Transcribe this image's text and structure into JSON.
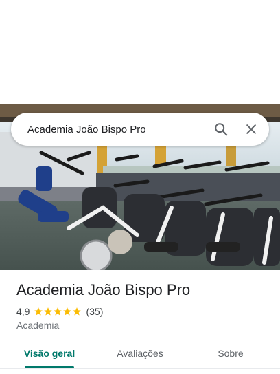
{
  "search": {
    "query": "Academia João Bispo Pro",
    "search_icon": "search-icon",
    "close_icon": "close-icon"
  },
  "hero": {
    "icon": "gym-photo"
  },
  "place": {
    "name": "Academia João Bispo Pro",
    "rating": "4,9",
    "stars": 5,
    "reviews": "(35)",
    "category": "Academia"
  },
  "tabs": [
    {
      "label": "Visão geral",
      "active": true
    },
    {
      "label": "Avaliações",
      "active": false
    },
    {
      "label": "Sobre",
      "active": false
    }
  ],
  "colors": {
    "accent": "#00796b",
    "star": "#fbbc04",
    "text_secondary": "#70757a"
  }
}
